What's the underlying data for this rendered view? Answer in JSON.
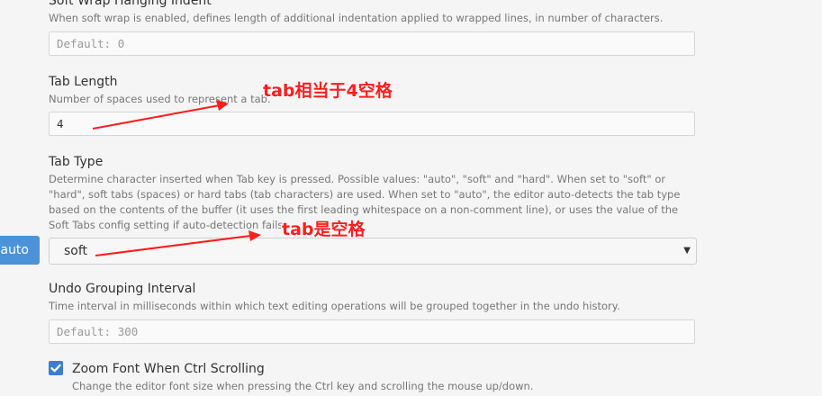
{
  "soft_wrap_hanging_indent": {
    "title": "Soft Wrap Hanging Indent",
    "description": "When soft wrap is enabled, defines length of additional indentation applied to wrapped lines, in number of characters.",
    "placeholder": "Default: 0"
  },
  "tab_length": {
    "title": "Tab Length",
    "description": "Number of spaces used to represent a tab.",
    "value": "4"
  },
  "tab_type": {
    "title": "Tab Type",
    "description_lines": [
      "Determine character inserted when Tab key is pressed. Possible values: \"auto\", \"soft\" and \"hard\". When set to \"soft\" or",
      "\"hard\", soft tabs (spaces) or hard tabs (tab characters) are used. When set to \"auto\", the editor auto-detects the tab type",
      "based on the contents of the buffer (it uses the first leading whitespace on a non-comment line), or uses the value of the",
      "Soft Tabs config setting if auto-detection fails."
    ],
    "selected": "soft",
    "tag": "auto"
  },
  "undo_grouping_interval": {
    "title": "Undo Grouping Interval",
    "description": "Time interval in milliseconds within which text editing operations will be grouped together in the undo history.",
    "placeholder": "Default: 300"
  },
  "zoom_font": {
    "title": "Zoom Font When Ctrl Scrolling",
    "description": "Change the editor font size when pressing the Ctrl key and scrolling the mouse up/down.",
    "checked": true
  },
  "annotations": {
    "tab_length_note": "tab相当于4空格",
    "tab_type_note": "tab是空格"
  },
  "colors": {
    "accent": "#3b7ed1",
    "annotation": "#ff1d1d"
  }
}
